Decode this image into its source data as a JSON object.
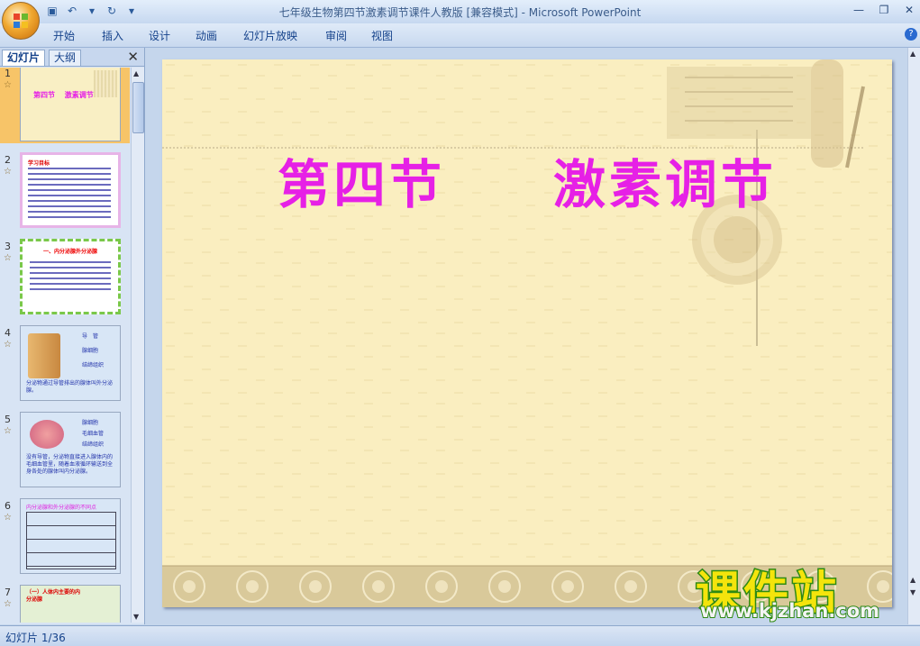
{
  "window": {
    "title": "七年级生物第四节激素调节课件人教版 [兼容模式] - Microsoft PowerPoint"
  },
  "ribbon_tabs": [
    "开始",
    "插入",
    "设计",
    "动画",
    "幻灯片放映",
    "审阅",
    "视图"
  ],
  "panel": {
    "tabs": [
      "幻灯片",
      "大纲"
    ]
  },
  "thumbnails": [
    {
      "num": "1",
      "title": "第四节　 激素调节"
    },
    {
      "num": "2",
      "title": "学习目标"
    },
    {
      "num": "3",
      "title": "一、内分泌腺外分泌腺"
    },
    {
      "num": "4",
      "labels": [
        "导　管",
        "腺细胞",
        "结缔组织"
      ],
      "caption": "分泌物通过导管排出的腺体叫外分泌腺。"
    },
    {
      "num": "5",
      "labels": [
        "腺细胞",
        "毛细血管",
        "结缔组织"
      ],
      "caption": "没有导管，分泌物直接进入腺体内的毛细血管里，随着血液循环输送到全身各处的腺体叫内分泌腺。"
    },
    {
      "num": "6",
      "title": "内分泌腺和外分泌腺的不同点"
    },
    {
      "num": "7",
      "title": "（一）人体内主要的内分泌腺"
    }
  ],
  "slide": {
    "title_part1": "第四节",
    "title_part2": "激素调节"
  },
  "status": {
    "slide_indicator": "幻灯片 1/36"
  },
  "watermark": {
    "name": "课件站",
    "url": "www.kjzhan.com"
  },
  "colors": {
    "slide_title": "#e620e6",
    "slide_bg": "#faeec0",
    "selected_thumb": "#f7c468",
    "watermark_text": "#f4e40c",
    "watermark_outline": "#2e8a14"
  }
}
